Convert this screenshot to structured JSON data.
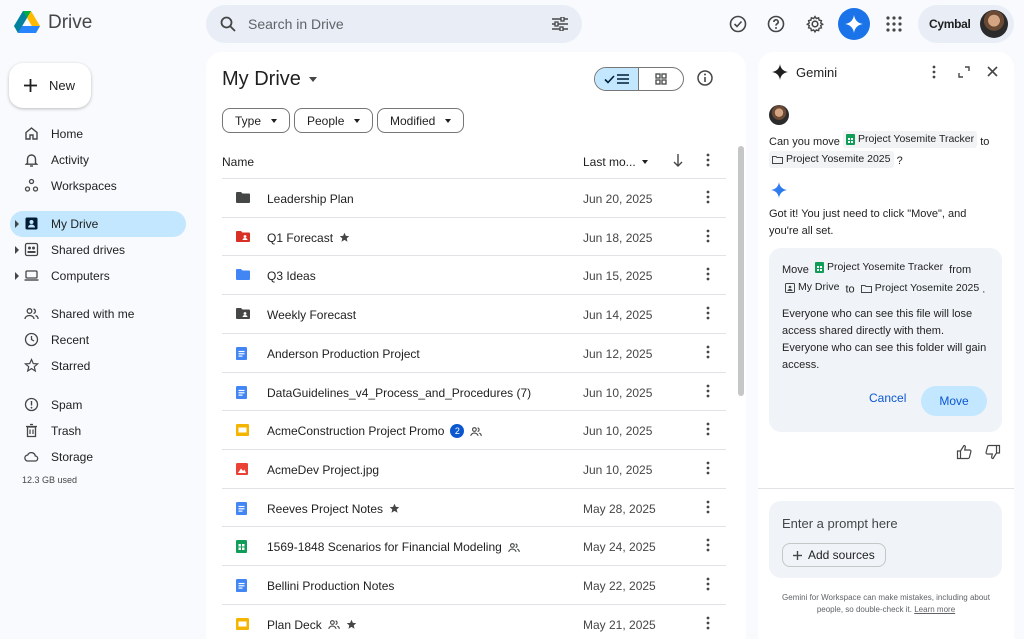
{
  "app": {
    "title": "Drive"
  },
  "search": {
    "placeholder": "Search in Drive"
  },
  "account": {
    "name": "Cymbal"
  },
  "sidebar": {
    "new_label": "New",
    "items": [
      {
        "label": "Home",
        "icon": "home-icon"
      },
      {
        "label": "Activity",
        "icon": "bell-icon"
      },
      {
        "label": "Workspaces",
        "icon": "workspaces-icon"
      },
      {
        "label": "My Drive",
        "icon": "my-drive-icon",
        "active": true
      },
      {
        "label": "Shared drives",
        "icon": "shared-drives-icon"
      },
      {
        "label": "Computers",
        "icon": "computer-icon"
      },
      {
        "label": "Shared with me",
        "icon": "people-icon"
      },
      {
        "label": "Recent",
        "icon": "clock-icon"
      },
      {
        "label": "Starred",
        "icon": "star-icon"
      },
      {
        "label": "Spam",
        "icon": "spam-icon"
      },
      {
        "label": "Trash",
        "icon": "trash-icon"
      },
      {
        "label": "Storage",
        "icon": "cloud-icon"
      }
    ],
    "storage_used": "12.3 GB used"
  },
  "main": {
    "title": "My Drive",
    "filters": [
      "Type",
      "People",
      "Modified"
    ],
    "columns": {
      "name": "Name",
      "modified": "Last mo..."
    },
    "files": [
      {
        "name": "Leadership Plan",
        "date": "Jun 20, 2025",
        "icon": "folder-icon",
        "color": "#444746"
      },
      {
        "name": "Q1 Forecast",
        "date": "Jun 18, 2025",
        "icon": "shared-folder-icon",
        "color": "#d93025",
        "starred": true
      },
      {
        "name": "Q3 Ideas",
        "date": "Jun 15, 2025",
        "icon": "folder-icon",
        "color": "#4285f4"
      },
      {
        "name": "Weekly Forecast",
        "date": "Jun 14, 2025",
        "icon": "shared-folder-icon",
        "color": "#444746"
      },
      {
        "name": "Anderson Production Project",
        "date": "Jun 12, 2025",
        "icon": "docs-icon",
        "color": "#4285f4"
      },
      {
        "name": "DataGuidelines_v4_Process_and_Procedures (7)",
        "date": "Jun 10, 2025",
        "icon": "docs-icon",
        "color": "#4285f4"
      },
      {
        "name": "AcmeConstruction Project Promo",
        "date": "Jun 10, 2025",
        "icon": "slides-icon",
        "color": "#f4b400",
        "badge": "2",
        "shared": true
      },
      {
        "name": "AcmeDev Project.jpg",
        "date": "Jun 10, 2025",
        "icon": "image-icon",
        "color": "#ea4335"
      },
      {
        "name": "Reeves Project Notes",
        "date": "May 28, 2025",
        "icon": "docs-icon",
        "color": "#4285f4",
        "starred": true
      },
      {
        "name": "1569-1848 Scenarios for Financial Modeling",
        "date": "May 24, 2025",
        "icon": "sheets-icon",
        "color": "#0f9d58",
        "shared": true
      },
      {
        "name": "Bellini Production Notes",
        "date": "May 22, 2025",
        "icon": "docs-icon",
        "color": "#4285f4"
      },
      {
        "name": "Plan Deck",
        "date": "May 21, 2025",
        "icon": "slides-icon",
        "color": "#f4b400",
        "shared": true,
        "starred": true
      }
    ]
  },
  "gemini": {
    "title": "Gemini",
    "user_msg": {
      "prefix": "Can you move",
      "file": "Project Yosemite Tracker",
      "mid": "to",
      "folder": "Project Yosemite 2025",
      "suffix": "?"
    },
    "reply": "Got it! You just need to click \"Move\", and you're all set.",
    "card": {
      "move_word": "Move",
      "file": "Project Yosemite Tracker",
      "from": "from",
      "source": "My Drive",
      "to": "to",
      "dest": "Project Yosemite 2025",
      "period": ".",
      "warning": "Everyone who can see this file will lose access shared directly with them. Everyone who can see this folder will gain access.",
      "cancel": "Cancel",
      "move": "Move"
    },
    "prompt_placeholder": "Enter a prompt here",
    "add_sources": "Add sources",
    "disclaimer": "Gemini for Workspace can make mistakes, including about people, so double-check it.",
    "learn_more": "Learn more"
  }
}
